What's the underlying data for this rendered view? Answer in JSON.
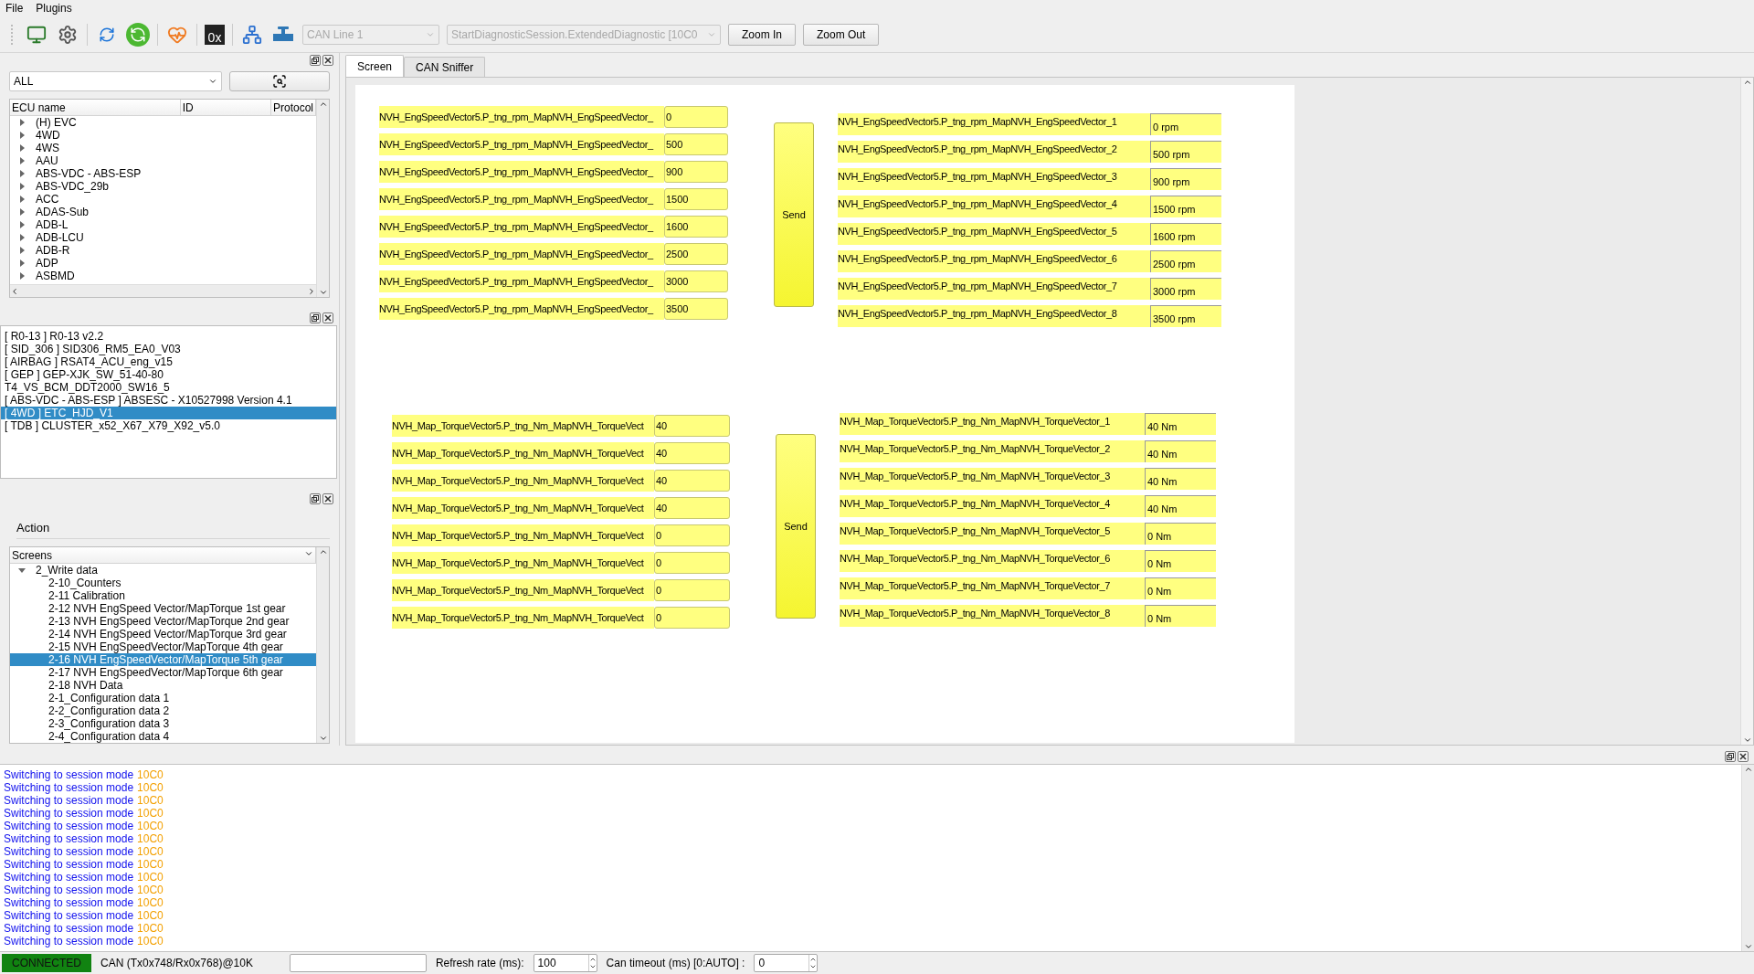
{
  "menu": [
    "File",
    "Plugins"
  ],
  "toolbar": {
    "hex_label": "0x",
    "can_line": {
      "value": "CAN Line 1",
      "disabled": true
    },
    "session": {
      "value": "StartDiagnosticSession.ExtendedDiagnostic [10C0",
      "disabled": true
    },
    "buttons": [
      "Zoom In",
      "Zoom Out"
    ]
  },
  "ecu_panel": {
    "filter": "ALL",
    "columns": [
      "ECU name",
      "ID",
      "Protocol"
    ],
    "items": [
      {
        "name": "(H) EVC",
        "expanded": false
      },
      {
        "name": "4WD",
        "expanded": false
      },
      {
        "name": "4WS",
        "expanded": false
      },
      {
        "name": "AAU",
        "expanded": false
      },
      {
        "name": "ABS-VDC - ABS-ESP",
        "expanded": false
      },
      {
        "name": "ABS-VDC_29b",
        "expanded": false
      },
      {
        "name": "ACC",
        "expanded": false
      },
      {
        "name": "ADAS-Sub",
        "expanded": false
      },
      {
        "name": "ADB-L",
        "expanded": false
      },
      {
        "name": "ADB-LCU",
        "expanded": false
      },
      {
        "name": "ADB-R",
        "expanded": false
      },
      {
        "name": "ADP",
        "expanded": false
      },
      {
        "name": "ASBMD",
        "expanded": false
      }
    ]
  },
  "ecu_list": [
    {
      "text": "[ R0-13 ] R0-13 v2.2",
      "selected": false
    },
    {
      "text": "[ SID_306 ] SID306_RM5_EA0_V03",
      "selected": false
    },
    {
      "text": "[ AIRBAG ] RSAT4_ACU_eng_v15",
      "selected": false
    },
    {
      "text": "[ GEP ] GEP-XJK_SW_51-40-80",
      "selected": false
    },
    {
      "text": "T4_VS_BCM_DDT2000_SW16_5",
      "selected": false
    },
    {
      "text": "[ ABS-VDC - ABS-ESP ] ABSESC - X10527998 Version 4.1",
      "selected": false
    },
    {
      "text": "[ 4WD ] ETC_HJD_V1",
      "selected": true
    },
    {
      "text": "[ TDB ] CLUSTER_x52_X67_X79_X92_v5.0",
      "selected": false
    }
  ],
  "action_panel": {
    "title": "Action",
    "combo": "Screens",
    "tree": [
      {
        "label": "2_Write data",
        "expanded": true,
        "children": [
          {
            "label": "2-10_Counters",
            "selected": false
          },
          {
            "label": "2-11 Calibration",
            "selected": false
          },
          {
            "label": "2-12 NVH EngSpeed Vector/MapTorque 1st gear",
            "selected": false
          },
          {
            "label": "2-13 NVH EngSpeed Vector/MapTorque 2nd gear",
            "selected": false
          },
          {
            "label": "2-14 NVH EngSpeed Vector/MapTorque 3rd gear",
            "selected": false
          },
          {
            "label": "2-15 NVH EngSpeedVector/MapTorque 4th gear",
            "selected": false
          },
          {
            "label": "2-16 NVH EngSpeedVector/MapTorque 5th gear",
            "selected": true
          },
          {
            "label": "2-17 NVH EngSpeedVector/MapTorque 6th gear",
            "selected": false
          },
          {
            "label": "2-18 NVH Data",
            "selected": false
          },
          {
            "label": "2-1_Configuration data 1",
            "selected": false
          },
          {
            "label": "2-2_Configuration data 2",
            "selected": false
          },
          {
            "label": "2-3_Configuration data 3",
            "selected": false
          },
          {
            "label": "2-4_Configuration data 4",
            "selected": false
          }
        ]
      }
    ]
  },
  "tabs": [
    {
      "label": "Screen",
      "selected": true
    },
    {
      "label": "CAN Sniffer",
      "selected": false
    }
  ],
  "screen": {
    "groups": [
      {
        "send": "Send",
        "inputs": [
          {
            "label": "NVH_EngSpeedVector5.P_tng_rpm_MapNVH_EngSpeedVector_",
            "value": "0"
          },
          {
            "label": "NVH_EngSpeedVector5.P_tng_rpm_MapNVH_EngSpeedVector_",
            "value": "500"
          },
          {
            "label": "NVH_EngSpeedVector5.P_tng_rpm_MapNVH_EngSpeedVector_",
            "value": "900"
          },
          {
            "label": "NVH_EngSpeedVector5.P_tng_rpm_MapNVH_EngSpeedVector_",
            "value": "1500"
          },
          {
            "label": "NVH_EngSpeedVector5.P_tng_rpm_MapNVH_EngSpeedVector_",
            "value": "1600"
          },
          {
            "label": "NVH_EngSpeedVector5.P_tng_rpm_MapNVH_EngSpeedVector_",
            "value": "2500"
          },
          {
            "label": "NVH_EngSpeedVector5.P_tng_rpm_MapNVH_EngSpeedVector_",
            "value": "3000"
          },
          {
            "label": "NVH_EngSpeedVector5.P_tng_rpm_MapNVH_EngSpeedVector_",
            "value": "3500"
          }
        ],
        "outputs": [
          {
            "label": "NVH_EngSpeedVector5.P_tng_rpm_MapNVH_EngSpeedVector_1",
            "value": "0 rpm"
          },
          {
            "label": "NVH_EngSpeedVector5.P_tng_rpm_MapNVH_EngSpeedVector_2",
            "value": "500 rpm"
          },
          {
            "label": "NVH_EngSpeedVector5.P_tng_rpm_MapNVH_EngSpeedVector_3",
            "value": "900 rpm"
          },
          {
            "label": "NVH_EngSpeedVector5.P_tng_rpm_MapNVH_EngSpeedVector_4",
            "value": "1500 rpm"
          },
          {
            "label": "NVH_EngSpeedVector5.P_tng_rpm_MapNVH_EngSpeedVector_5",
            "value": "1600 rpm"
          },
          {
            "label": "NVH_EngSpeedVector5.P_tng_rpm_MapNVH_EngSpeedVector_6",
            "value": "2500 rpm"
          },
          {
            "label": "NVH_EngSpeedVector5.P_tng_rpm_MapNVH_EngSpeedVector_7",
            "value": "3000 rpm"
          },
          {
            "label": "NVH_EngSpeedVector5.P_tng_rpm_MapNVH_EngSpeedVector_8",
            "value": "3500 rpm"
          }
        ]
      },
      {
        "send": "Send",
        "inputs": [
          {
            "label": "NVH_Map_TorqueVector5.P_tng_Nm_MapNVH_TorqueVect",
            "value": "40"
          },
          {
            "label": "NVH_Map_TorqueVector5.P_tng_Nm_MapNVH_TorqueVect",
            "value": "40"
          },
          {
            "label": "NVH_Map_TorqueVector5.P_tng_Nm_MapNVH_TorqueVect",
            "value": "40"
          },
          {
            "label": "NVH_Map_TorqueVector5.P_tng_Nm_MapNVH_TorqueVect",
            "value": "40"
          },
          {
            "label": "NVH_Map_TorqueVector5.P_tng_Nm_MapNVH_TorqueVect",
            "value": "0"
          },
          {
            "label": "NVH_Map_TorqueVector5.P_tng_Nm_MapNVH_TorqueVect",
            "value": "0"
          },
          {
            "label": "NVH_Map_TorqueVector5.P_tng_Nm_MapNVH_TorqueVect",
            "value": "0"
          },
          {
            "label": "NVH_Map_TorqueVector5.P_tng_Nm_MapNVH_TorqueVect",
            "value": "0"
          }
        ],
        "outputs": [
          {
            "label": "NVH_Map_TorqueVector5.P_tng_Nm_MapNVH_TorqueVector_1",
            "value": "40 Nm"
          },
          {
            "label": "NVH_Map_TorqueVector5.P_tng_Nm_MapNVH_TorqueVector_2",
            "value": "40 Nm"
          },
          {
            "label": "NVH_Map_TorqueVector5.P_tng_Nm_MapNVH_TorqueVector_3",
            "value": "40 Nm"
          },
          {
            "label": "NVH_Map_TorqueVector5.P_tng_Nm_MapNVH_TorqueVector_4",
            "value": "40 Nm"
          },
          {
            "label": "NVH_Map_TorqueVector5.P_tng_Nm_MapNVH_TorqueVector_5",
            "value": "0 Nm"
          },
          {
            "label": "NVH_Map_TorqueVector5.P_tng_Nm_MapNVH_TorqueVector_6",
            "value": "0 Nm"
          },
          {
            "label": "NVH_Map_TorqueVector5.P_tng_Nm_MapNVH_TorqueVector_7",
            "value": "0 Nm"
          },
          {
            "label": "NVH_Map_TorqueVector5.P_tng_Nm_MapNVH_TorqueVector_8",
            "value": "0 Nm"
          }
        ]
      }
    ]
  },
  "log": [
    {
      "message": "Switching to session mode",
      "code": "10C0"
    },
    {
      "message": "Switching to session mode",
      "code": "10C0"
    },
    {
      "message": "Switching to session mode",
      "code": "10C0"
    },
    {
      "message": "Switching to session mode",
      "code": "10C0"
    },
    {
      "message": "Switching to session mode",
      "code": "10C0"
    },
    {
      "message": "Switching to session mode",
      "code": "10C0"
    },
    {
      "message": "Switching to session mode",
      "code": "10C0"
    },
    {
      "message": "Switching to session mode",
      "code": "10C0"
    },
    {
      "message": "Switching to session mode",
      "code": "10C0"
    },
    {
      "message": "Switching to session mode",
      "code": "10C0"
    },
    {
      "message": "Switching to session mode",
      "code": "10C0"
    },
    {
      "message": "Switching to session mode",
      "code": "10C0"
    },
    {
      "message": "Switching to session mode",
      "code": "10C0"
    },
    {
      "message": "Switching to session mode",
      "code": "10C0"
    }
  ],
  "status_bar": {
    "connection": "CONNECTED",
    "connected": true,
    "can_info": "CAN (Tx0x748/Rx0x768)@10K",
    "refresh_label": "Refresh rate (ms):",
    "refresh_value": "100",
    "timeout_label": "Can timeout (ms) [0:AUTO] :",
    "timeout_value": "0"
  }
}
